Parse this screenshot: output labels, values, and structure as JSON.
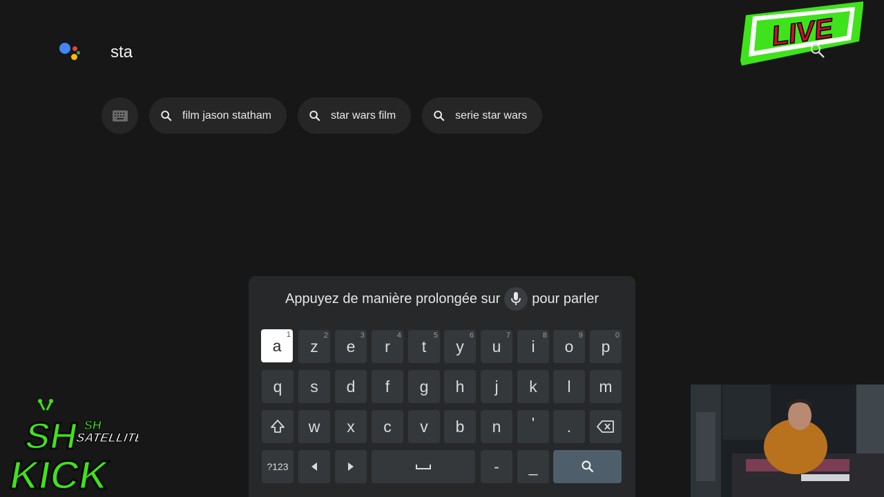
{
  "search": {
    "query": "sta",
    "colors": {
      "blue": "#4285f4",
      "red": "#ea4335",
      "yellow": "#fbbc05",
      "green": "#34a853"
    }
  },
  "live_badge": {
    "text": "LIVE",
    "bg": "#3fe31b",
    "text_color": "#c8102e"
  },
  "chips": [
    {
      "icon": "keyboard-icon",
      "label": ""
    },
    {
      "icon": "search-icon",
      "label": "film jason statham"
    },
    {
      "icon": "search-icon",
      "label": "star wars film"
    },
    {
      "icon": "search-icon",
      "label": "serie star wars"
    }
  ],
  "keyboard": {
    "hint_before": "Appuyez de manière prolongée sur",
    "hint_after": "pour parler",
    "row1": [
      {
        "k": "a",
        "n": "1"
      },
      {
        "k": "z",
        "n": "2"
      },
      {
        "k": "e",
        "n": "3"
      },
      {
        "k": "r",
        "n": "4"
      },
      {
        "k": "t",
        "n": "5"
      },
      {
        "k": "y",
        "n": "6"
      },
      {
        "k": "u",
        "n": "7"
      },
      {
        "k": "i",
        "n": "8"
      },
      {
        "k": "o",
        "n": "9"
      },
      {
        "k": "p",
        "n": "0"
      }
    ],
    "row2": [
      "q",
      "s",
      "d",
      "f",
      "g",
      "h",
      "j",
      "k",
      "l",
      "m"
    ],
    "row3": [
      "shift-icon",
      "w",
      "x",
      "c",
      "v",
      "b",
      "n",
      "'",
      ".",
      "backspace-icon"
    ],
    "row4": {
      "symbols": "?123",
      "left": "left-arrow-icon",
      "right": "right-arrow-icon",
      "space": "space-icon",
      "dash": "-",
      "underscore": "_",
      "search": "search-icon"
    },
    "selected": "a"
  },
  "overlay": {
    "logo_top": "SH",
    "logo_sub1": "SH",
    "logo_sub2": "SATELLITE",
    "logo_main": "KICK"
  }
}
